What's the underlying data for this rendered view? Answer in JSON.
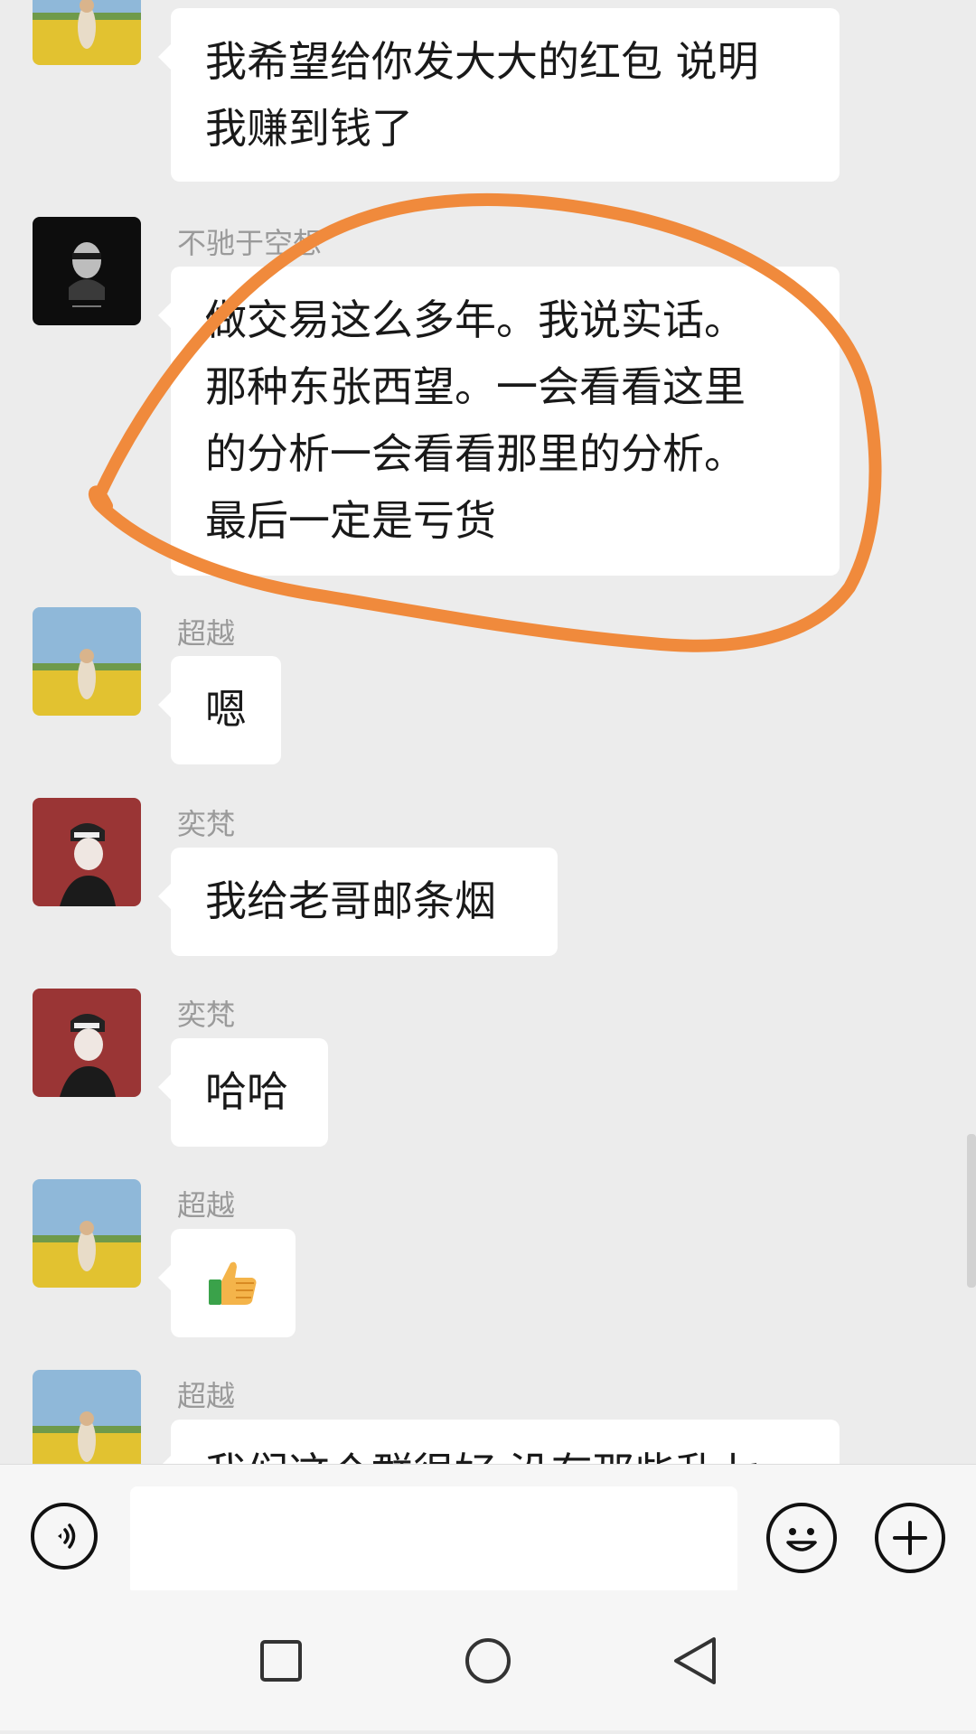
{
  "messages": [
    {
      "sender": "",
      "lines": [
        "我希望给你发大大的红包 说明",
        "我赚到钱了"
      ]
    },
    {
      "sender": "不驰于空想",
      "lines": [
        "做交易这么多年。我说实话。",
        "那种东张西望。一会看看这里",
        "的分析一会看看那里的分析。",
        "最后一定是亏货"
      ]
    },
    {
      "sender": "超越",
      "lines": [
        "嗯"
      ]
    },
    {
      "sender": "奕梵",
      "lines": [
        "我给老哥邮条烟"
      ]
    },
    {
      "sender": "奕梵",
      "lines": [
        "哈哈"
      ]
    },
    {
      "sender": "超越",
      "emoji": "thumbs-up-icon"
    },
    {
      "sender": "超越",
      "lines": [
        "我们这个群很好 没有那些乱七"
      ]
    }
  ],
  "annotation_color": "#f08a3c",
  "input": {
    "placeholder": "",
    "value": ""
  },
  "icons": {
    "voice": "voice-icon",
    "emoji": "emoji-icon",
    "more": "plus-icon",
    "nav_recent": "square-icon",
    "nav_home": "circle-icon",
    "nav_back": "triangle-back-icon"
  }
}
